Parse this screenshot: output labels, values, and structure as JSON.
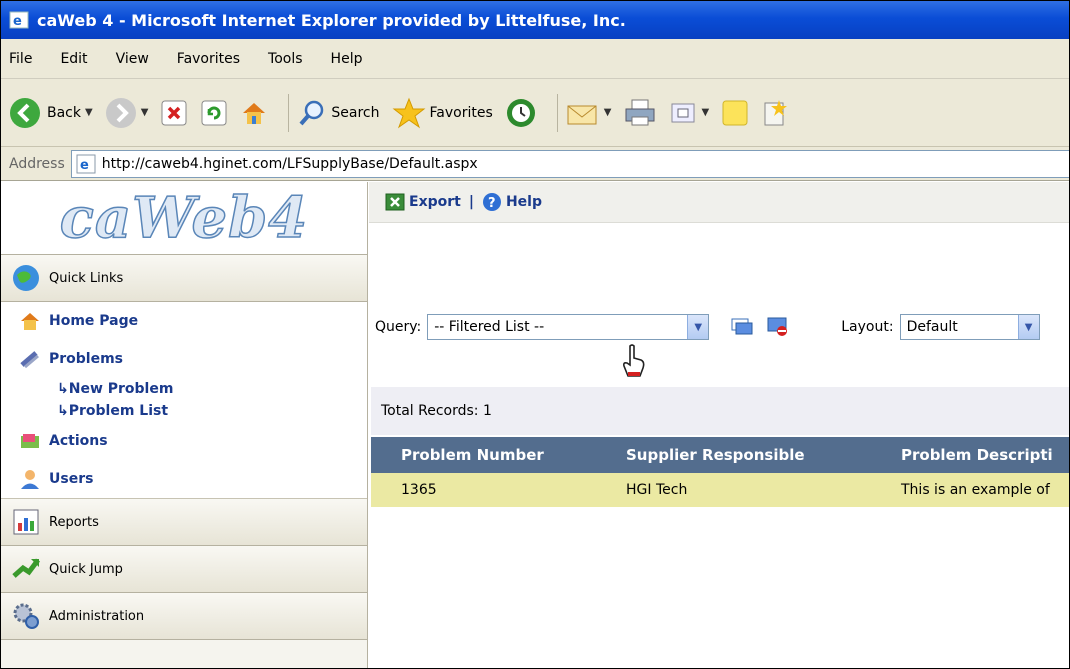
{
  "window": {
    "title": "caWeb 4 - Microsoft Internet Explorer provided by Littelfuse, Inc."
  },
  "menu": [
    "File",
    "Edit",
    "View",
    "Favorites",
    "Tools",
    "Help"
  ],
  "toolbar": {
    "back": "Back",
    "search": "Search",
    "favorites": "Favorites"
  },
  "address": {
    "label": "Address",
    "url": "http://caweb4.hginet.com/LFSupplyBase/Default.aspx"
  },
  "sidebar": {
    "logo": "caWeb4",
    "quick_links": "Quick Links",
    "home": "Home Page",
    "problems": "Problems",
    "new_problem": "↳New Problem",
    "problem_list": "↳Problem List",
    "actions": "Actions",
    "users": "Users",
    "reports": "Reports",
    "quick_jump": "Quick Jump",
    "administration": "Administration"
  },
  "main": {
    "export": "Export",
    "separator": "|",
    "help": "Help",
    "query_label": "Query:",
    "query_value": "-- Filtered List --",
    "layout_label": "Layout:",
    "layout_value": "Default",
    "total_records": "Total Records: 1",
    "columns": [
      "Problem Number",
      "Supplier Responsible",
      "Problem Descripti"
    ],
    "rows": [
      {
        "number": "1365",
        "supplier": "HGI Tech",
        "description": "This is an example of"
      }
    ]
  },
  "colors": {
    "title_bar": "#0a4dd6",
    "table_header": "#536d8e",
    "table_row": "#ebe9a3",
    "link": "#1a3a8c"
  }
}
